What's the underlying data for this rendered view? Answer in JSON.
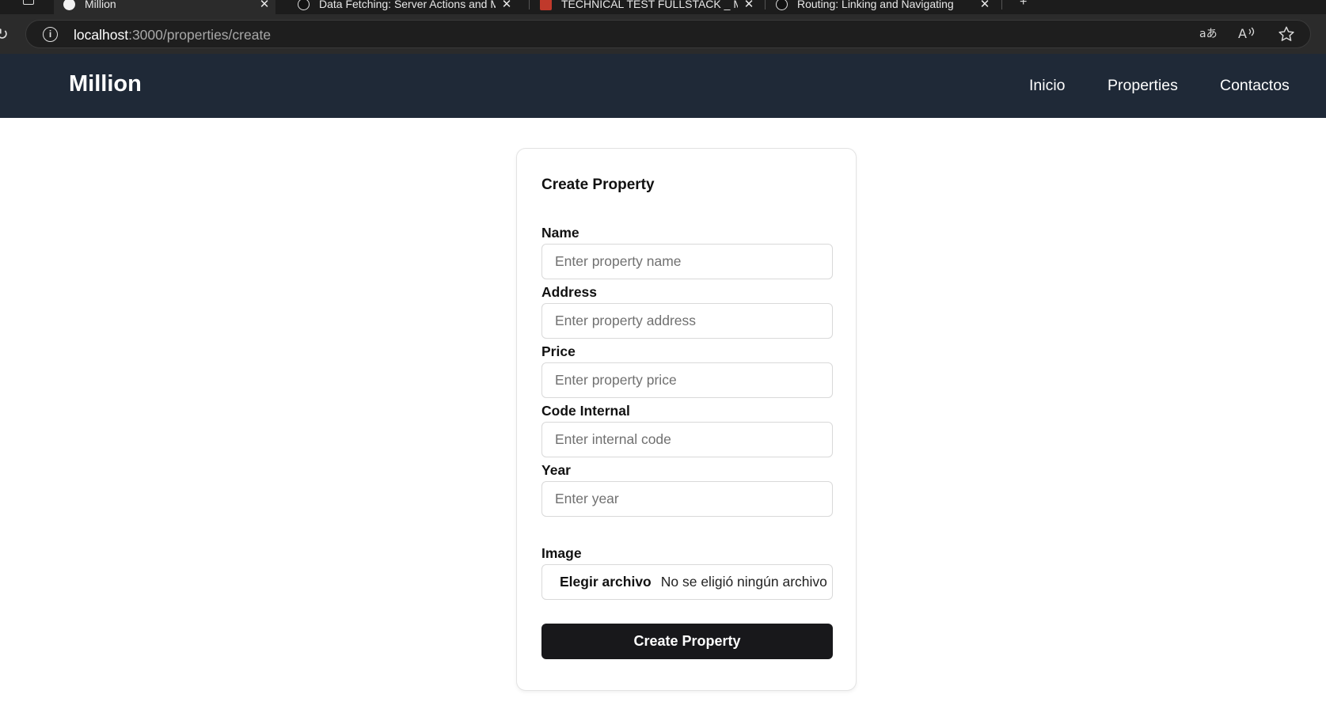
{
  "browser": {
    "tabs": [
      {
        "title": "Million",
        "active": true
      },
      {
        "title": "Data Fetching: Server Actions and Mutations"
      },
      {
        "title": "TECHNICAL TEST FULLSTACK _ MILLION"
      },
      {
        "title": "Routing: Linking and Navigating"
      }
    ],
    "new_tab": "+",
    "url_host": "localhost",
    "url_path": ":3000/properties/create",
    "icons": [
      "reload-icon",
      "info-icon",
      "translate-icon",
      "read-aloud-icon",
      "favorite-star-icon"
    ]
  },
  "nav": {
    "brand": "Million",
    "links": [
      "Inicio",
      "Properties",
      "Contactos"
    ]
  },
  "form": {
    "title": "Create Property",
    "fields": [
      {
        "label": "Name",
        "placeholder": "Enter property name",
        "value": ""
      },
      {
        "label": "Address",
        "placeholder": "Enter property address",
        "value": ""
      },
      {
        "label": "Price",
        "placeholder": "Enter property price",
        "value": ""
      },
      {
        "label": "Code Internal",
        "placeholder": "Enter internal code",
        "value": ""
      },
      {
        "label": "Year",
        "placeholder": "Enter year",
        "value": ""
      }
    ],
    "image": {
      "label": "Image",
      "button": "Elegir archivo",
      "status": "No se eligió ningún archivo"
    },
    "submit": "Create Property"
  },
  "colors": {
    "nav_bg": "#1f2937",
    "button_bg": "#18181b",
    "browser_bg": "#2b2b2b"
  }
}
